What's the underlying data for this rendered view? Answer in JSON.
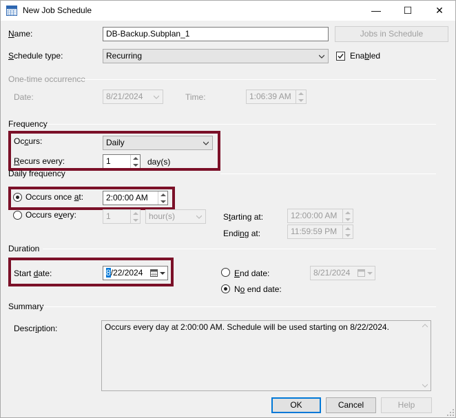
{
  "window": {
    "title": "New Job Schedule",
    "minimize_glyph": "—",
    "maximize_glyph": "☐",
    "close_glyph": "✕"
  },
  "name": {
    "label": "Name:",
    "value": "DB-Backup.Subplan_1",
    "jobs_button": "Jobs in Schedule"
  },
  "schedule_type": {
    "label": "Schedule type:",
    "value": "Recurring",
    "enabled_label": "Enabled",
    "enabled_checked": true
  },
  "one_time": {
    "group_title": "One-time occurrence",
    "date_label": "Date:",
    "date_value": "8/21/2024",
    "time_label": "Time:",
    "time_value": "1:06:39 AM"
  },
  "frequency": {
    "group_title": "Frequency",
    "occurs_label": "Occurs:",
    "occurs_value": "Daily",
    "recurs_label": "Recurs every:",
    "recurs_value": "1",
    "recurs_unit": "day(s)"
  },
  "daily_frequency": {
    "group_title": "Daily frequency",
    "once_label": "Occurs once at:",
    "once_value": "2:00:00 AM",
    "every_label": "Occurs every:",
    "every_value": "1",
    "every_unit": "hour(s)",
    "starting_label": "Starting at:",
    "starting_value": "12:00:00 AM",
    "ending_label": "Ending at:",
    "ending_value": "11:59:59 PM"
  },
  "duration": {
    "group_title": "Duration",
    "start_label": "Start date:",
    "start_value_first": "8",
    "start_value_rest": "/22/2024",
    "end_label": "End date:",
    "end_value": "8/21/2024",
    "no_end_label": "No end date:"
  },
  "summary": {
    "group_title": "Summary",
    "description_label": "Description:",
    "description_value": "Occurs every day at 2:00:00 AM. Schedule will be used starting on 8/22/2024."
  },
  "buttons": {
    "ok": "OK",
    "cancel": "Cancel",
    "help": "Help"
  },
  "colors": {
    "highlight_box": "#7b1028",
    "selection": "#0078d7"
  }
}
